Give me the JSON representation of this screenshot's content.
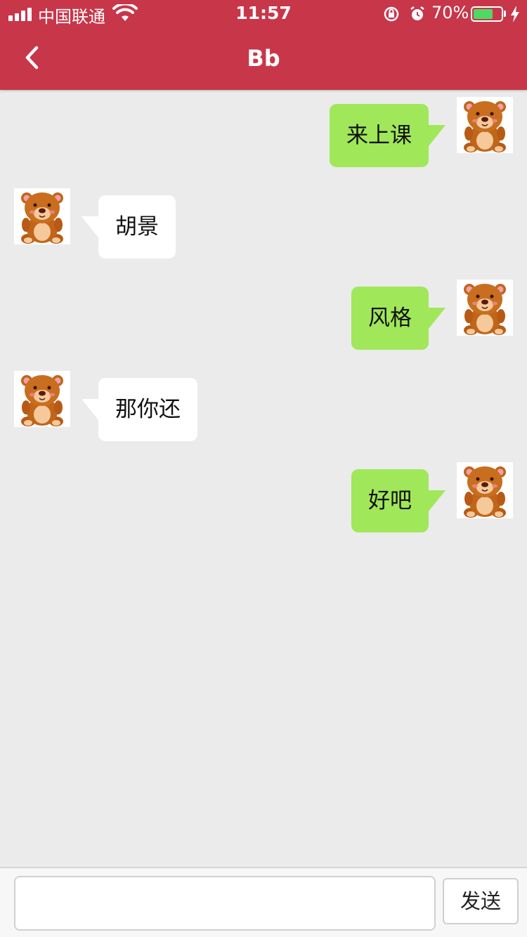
{
  "status_bar": {
    "carrier": "中国联通",
    "time": "11:57",
    "battery_percent": "70%",
    "battery_level": 0.7,
    "icons": [
      "signal-icon",
      "wifi-icon",
      "rotation-lock-icon",
      "alarm-icon",
      "battery-icon",
      "charging-icon"
    ]
  },
  "header": {
    "title": "Bb",
    "back_icon": "chevron-left-icon"
  },
  "messages": [
    {
      "side": "right",
      "text": "来上课"
    },
    {
      "side": "left",
      "text": "胡景"
    },
    {
      "side": "right",
      "text": "风格"
    },
    {
      "side": "left",
      "text": "那你还"
    },
    {
      "side": "right",
      "text": "好吧"
    }
  ],
  "input_bar": {
    "value": "",
    "placeholder": "",
    "send_label": "发送"
  },
  "colors": {
    "header_bg": "#c8364a",
    "sent_bubble": "#a0e75a",
    "received_bubble": "#ffffff",
    "chat_bg": "#ebebeb",
    "battery_fill": "#4cd964"
  }
}
